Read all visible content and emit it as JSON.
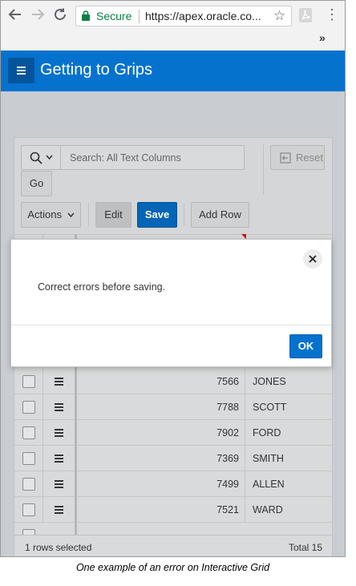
{
  "browser": {
    "secure_label": "Secure",
    "url": "https://apex.oracle.co...",
    "overflow_label": "»"
  },
  "app": {
    "title": "Getting to Grips",
    "accent_color": "#0572ce"
  },
  "grid": {
    "search_placeholder": "Search: All Text Columns",
    "reset_label": "Reset",
    "go_label": "Go",
    "actions_label": "Actions",
    "edit_label": "Edit",
    "save_label": "Save",
    "add_row_label": "Add Row",
    "rows": [
      {
        "empno": "7566",
        "ename": "JONES"
      },
      {
        "empno": "7788",
        "ename": "SCOTT"
      },
      {
        "empno": "7902",
        "ename": "FORD"
      },
      {
        "empno": "7369",
        "ename": "SMITH"
      },
      {
        "empno": "7499",
        "ename": "ALLEN"
      },
      {
        "empno": "7521",
        "ename": "WARD"
      }
    ],
    "footer_selected": "1 rows selected",
    "footer_total": "Total 15"
  },
  "dialog": {
    "message": "Correct errors before saving.",
    "ok_label": "OK"
  },
  "caption": "One example of an error on Interactive Grid"
}
